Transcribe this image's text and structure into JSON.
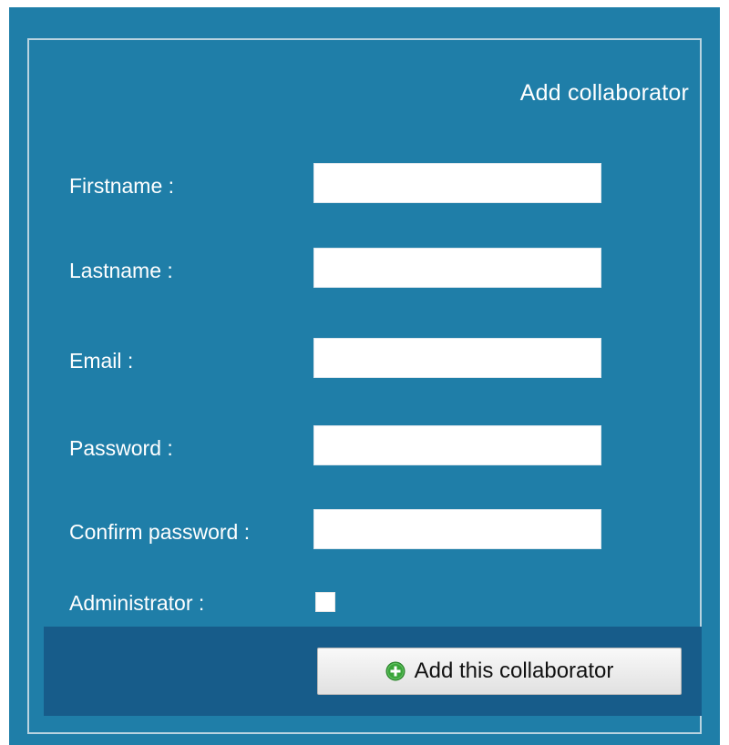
{
  "form": {
    "title": "Add collaborator",
    "fields": [
      {
        "label": "Firstname :",
        "value": "",
        "placeholder": ""
      },
      {
        "label": "Lastname :",
        "value": "",
        "placeholder": ""
      },
      {
        "label": "Email :",
        "value": "",
        "placeholder": ""
      },
      {
        "label": "Password :",
        "value": "",
        "placeholder": ""
      },
      {
        "label": "Confirm password :",
        "value": "",
        "placeholder": ""
      }
    ],
    "administrator": {
      "label": "Administrator :",
      "checked": false
    },
    "submit": {
      "label": "Add this collaborator",
      "icon": "plus-circle-icon"
    }
  },
  "colors": {
    "panel_background": "#1f7ea8",
    "footer_background": "#175c8a",
    "frame_border": "#b9d3e0",
    "icon_green": "#3aa53a"
  }
}
